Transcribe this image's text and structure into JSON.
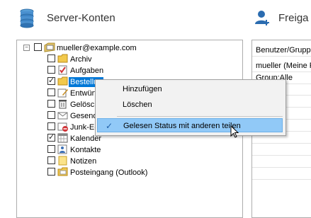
{
  "header": {
    "server_accounts_title": "Server-Konten",
    "share_title": "Freiga"
  },
  "tree": {
    "root": {
      "label": "mueller@example.com",
      "expander": "−"
    },
    "items": [
      {
        "label": "Archiv",
        "checked": false,
        "icon": "folder-icon"
      },
      {
        "label": "Aufgaben",
        "checked": false,
        "icon": "tasks-icon"
      },
      {
        "label": "Bestellun",
        "checked": true,
        "icon": "folder-icon",
        "selected": true
      },
      {
        "label": "Entwürfe",
        "checked": false,
        "icon": "drafts-icon"
      },
      {
        "label": "Gelösch",
        "checked": false,
        "icon": "deleted-icon"
      },
      {
        "label": "Gesende",
        "checked": false,
        "icon": "sent-icon"
      },
      {
        "label": "Junk-E-N",
        "checked": false,
        "icon": "junk-icon"
      },
      {
        "label": "Kalender",
        "checked": true,
        "icon": "calendar-icon"
      },
      {
        "label": "Kontakte",
        "checked": false,
        "icon": "contacts-icon"
      },
      {
        "label": "Notizen",
        "checked": false,
        "icon": "notes-icon"
      },
      {
        "label": "Posteingang (Outlook)",
        "checked": false,
        "icon": "inbox-icon"
      }
    ]
  },
  "share_panel": {
    "rows": [
      "Benutzer/Grupp",
      "mueller (Meine F",
      "Group:Alle"
    ]
  },
  "context_menu": {
    "add_label": "Hinzufügen",
    "delete_label": "Löschen",
    "share_read_status_label": "Gelesen Status mit anderen teilen",
    "share_read_status_checked": true,
    "check_glyph": "✓"
  }
}
